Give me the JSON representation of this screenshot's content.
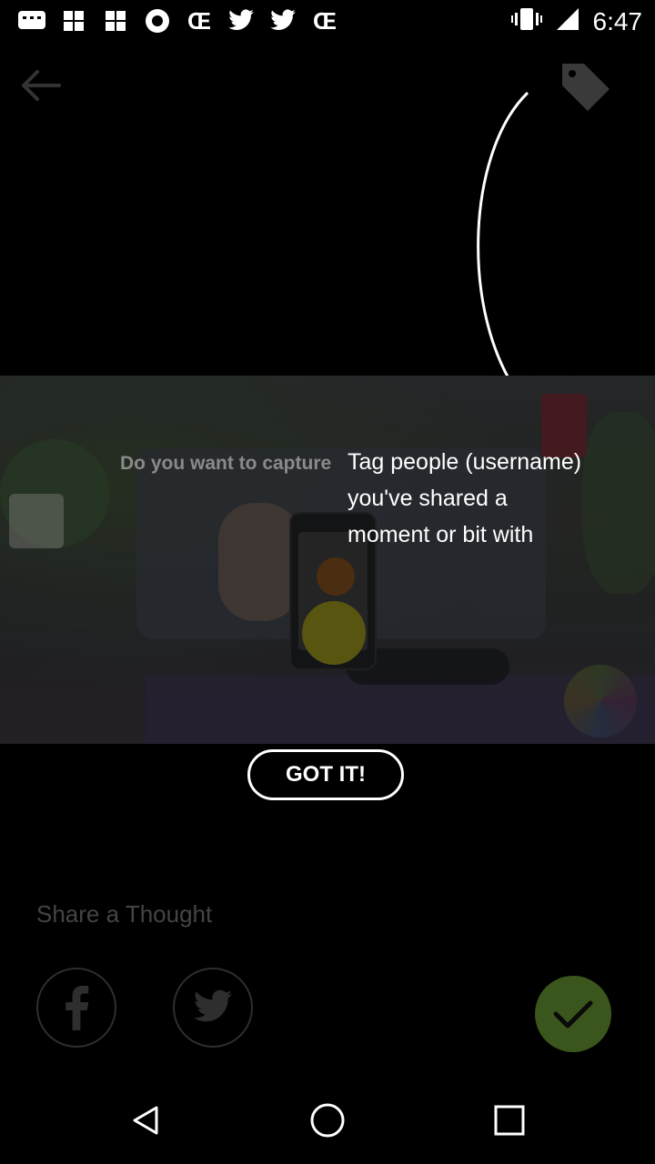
{
  "status_bar": {
    "time": "6:47",
    "icons": [
      "message-icon",
      "pinwheel-icon",
      "pinwheel-icon",
      "circle-record-icon",
      "ce-icon",
      "twitter-icon",
      "twitter-icon",
      "ce-icon",
      "vibrate-icon",
      "signal-icon"
    ]
  },
  "header": {
    "back_icon": "arrow-left-icon",
    "tag_icon": "tag-icon"
  },
  "preview": {
    "overlay_text": "Do you want to capture"
  },
  "tooltip": {
    "line1": "Tag people (username)",
    "line2": "you've shared a",
    "line3": "moment or bit with"
  },
  "gotit": {
    "label": "GOT IT!"
  },
  "share": {
    "label": "Share a Thought",
    "facebook_icon": "facebook-icon",
    "twitter_icon": "twitter-icon",
    "confirm_icon": "check-icon"
  },
  "nav": {
    "back": "nav-back-icon",
    "home": "nav-home-icon",
    "recent": "nav-recent-icon"
  },
  "colors": {
    "background": "#000000",
    "confirm": "#3a561c",
    "text_dim": "#444444"
  }
}
